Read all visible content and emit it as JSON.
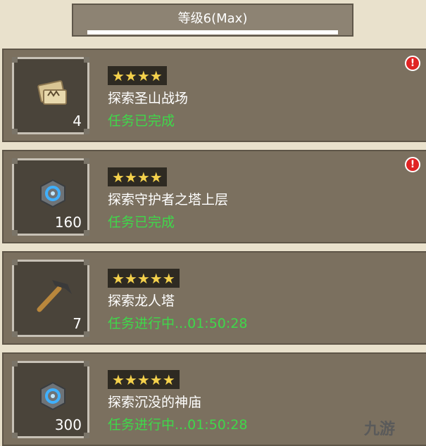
{
  "header": {
    "level_title": "等级6(Max)",
    "level_progress": 1.0
  },
  "tasks": [
    {
      "icon": "map-icon",
      "count": "4",
      "stars": "★★★★",
      "name": "探索圣山战场",
      "status": "任务已完成",
      "alert": "!"
    },
    {
      "icon": "blue-rune-stone-icon",
      "count": "160",
      "stars": "★★★★",
      "name": "探索守护者之塔上层",
      "status": "任务已完成",
      "alert": "!"
    },
    {
      "icon": "pickaxe-icon",
      "count": "7",
      "stars": "★★★★★",
      "name": "探索龙人塔",
      "status": "任务进行中...01:50:28"
    },
    {
      "icon": "blue-rune-stone-icon",
      "count": "300",
      "stars": "★★★★★",
      "name": "探索沉没的神庙",
      "status": "任务进行中...01:50:28"
    }
  ],
  "watermark": "九游",
  "colors": {
    "status_green": "#3fd84a",
    "star_yellow": "#f4d14c",
    "card_bg": "#7b705f"
  }
}
